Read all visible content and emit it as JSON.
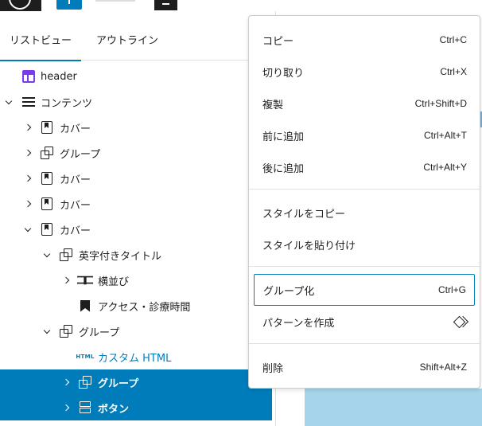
{
  "colors": {
    "accent": "#007cba",
    "selected_bg": "#007cba",
    "header_icon": "#7c3aed",
    "canvas_highlight": "#a6d4ea"
  },
  "tabs": [
    {
      "label": "リストビュー",
      "active": true
    },
    {
      "label": "アウトライン",
      "active": false
    }
  ],
  "tree": [
    {
      "label": "header",
      "icon": "template-part-header-icon",
      "expanded": null,
      "selected": false
    },
    {
      "label": "コンテンツ",
      "icon": "list-icon",
      "expanded": true,
      "selected": false
    },
    {
      "label": "カバー",
      "icon": "cover-icon",
      "expanded": false,
      "selected": false
    },
    {
      "label": "グループ",
      "icon": "group-icon",
      "expanded": false,
      "selected": false
    },
    {
      "label": "カバー",
      "icon": "cover-icon",
      "expanded": false,
      "selected": false
    },
    {
      "label": "カバー",
      "icon": "cover-icon",
      "expanded": false,
      "selected": false
    },
    {
      "label": "カバー",
      "icon": "cover-icon",
      "expanded": true,
      "selected": false
    },
    {
      "label": "英字付きタイトル",
      "icon": "group-icon",
      "expanded": true,
      "selected": false
    },
    {
      "label": "横並び",
      "icon": "row-icon",
      "expanded": false,
      "selected": false
    },
    {
      "label": "アクセス・診療時間",
      "icon": "bookmark-icon",
      "expanded": null,
      "selected": false
    },
    {
      "label": "グループ",
      "icon": "group-icon",
      "expanded": true,
      "selected": false
    },
    {
      "label": "カスタム HTML",
      "icon": "html-icon",
      "expanded": null,
      "selected": false
    },
    {
      "label": "グループ",
      "icon": "group-icon",
      "expanded": false,
      "selected": true
    },
    {
      "label": "ボタン",
      "icon": "buttons-icon",
      "expanded": false,
      "selected": true
    }
  ],
  "html_icon_text": "HTML",
  "menu": {
    "group1": [
      {
        "label": "コピー",
        "shortcut": "Ctrl+C"
      },
      {
        "label": "切り取り",
        "shortcut": "Ctrl+X"
      },
      {
        "label": "複製",
        "shortcut": "Ctrl+Shift+D"
      },
      {
        "label": "前に追加",
        "shortcut": "Ctrl+Alt+T"
      },
      {
        "label": "後に追加",
        "shortcut": "Ctrl+Alt+Y"
      }
    ],
    "group2": [
      {
        "label": "スタイルをコピー"
      },
      {
        "label": "スタイルを貼り付け"
      }
    ],
    "group3": [
      {
        "label": "グループ化",
        "shortcut": "Ctrl+G",
        "focused": true
      },
      {
        "label": "パターンを作成",
        "icon": "pattern-icon"
      }
    ],
    "group4": [
      {
        "label": "削除",
        "shortcut": "Shift+Alt+Z"
      }
    ]
  }
}
